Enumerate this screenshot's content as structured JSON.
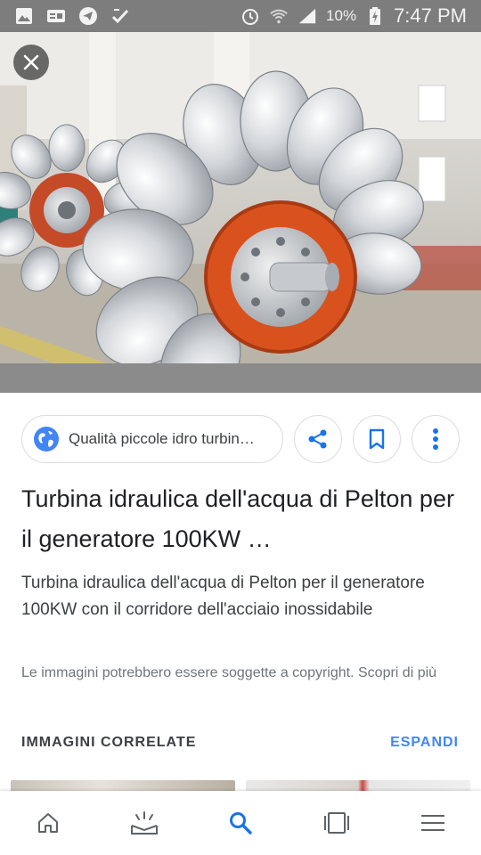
{
  "status_bar": {
    "battery_percent": "10%",
    "time": "7:47 PM",
    "icons": [
      "gallery-icon",
      "ge-icon",
      "telegram-icon",
      "check-icon",
      "alarm-icon",
      "wifi-icon",
      "signal-icon",
      "battery-charging-icon"
    ]
  },
  "hero": {
    "close_icon": "close-icon"
  },
  "source": {
    "label": "Qualità piccole idro turbin…",
    "icon": "globe-icon"
  },
  "actions": {
    "share_icon": "share-icon",
    "bookmark_icon": "bookmark-icon",
    "more_icon": "more-vert-icon"
  },
  "result": {
    "title": "Turbina idraulica dell'acqua di Pelton per il generatore 100KW …",
    "description": "Turbina idraulica dell'acqua di Pelton per il generatore 100KW con il corridore dell'acciaio inossidabile",
    "copyright": "Le immagini potrebbero essere soggette a copyright. Scopri di più"
  },
  "related": {
    "label": "IMMAGINI CORRELATE",
    "expand_label": "ESPANDI"
  },
  "bottom_nav": {
    "items": [
      "home-icon",
      "updates-icon",
      "search-icon",
      "tabs-icon",
      "menu-icon"
    ],
    "active": "search-icon"
  },
  "colors": {
    "accent": "#4285f4",
    "status_bar": "#7d7d7d",
    "runner_orange": "#d9521e"
  }
}
